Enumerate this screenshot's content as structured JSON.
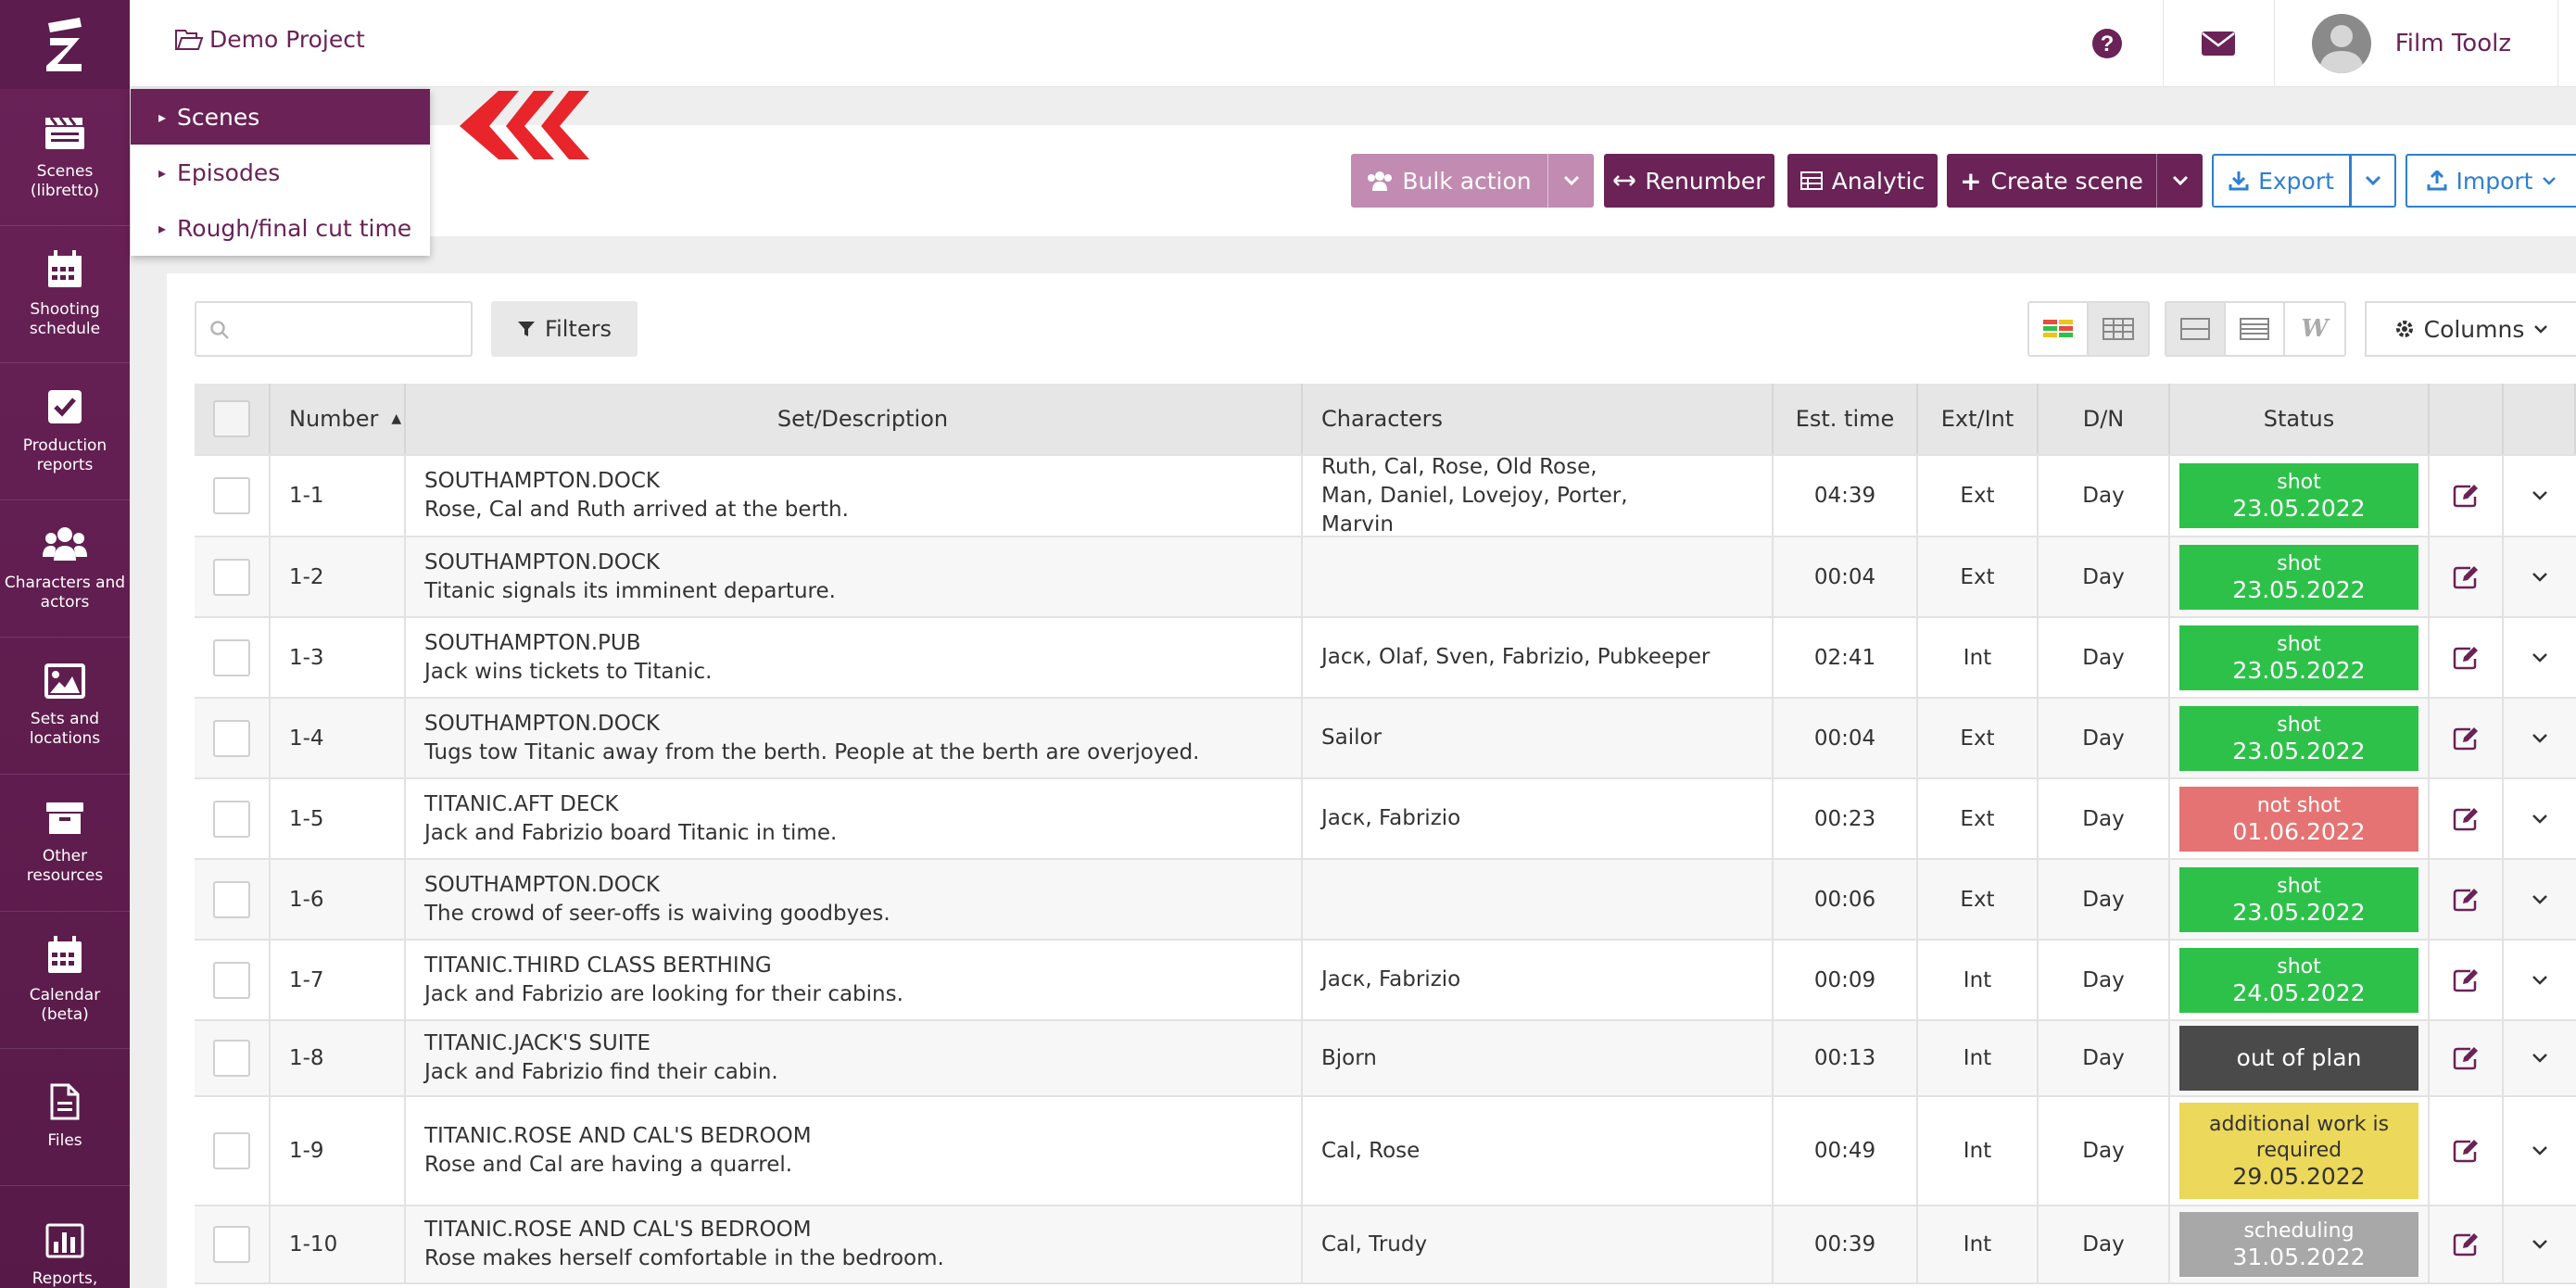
{
  "sidebar": {
    "items": [
      {
        "label": "Scenes (libretto)",
        "icon": "clapperboard-icon"
      },
      {
        "label": "Shooting schedule",
        "icon": "calendar-icon"
      },
      {
        "label": "Production reports",
        "icon": "checkbox-icon"
      },
      {
        "label": "Characters and actors",
        "icon": "users-icon"
      },
      {
        "label": "Sets and locations",
        "icon": "image-icon"
      },
      {
        "label": "Other resources",
        "icon": "archive-icon"
      },
      {
        "label": "Calendar (beta)",
        "icon": "calendar-icon"
      },
      {
        "label": "Files",
        "icon": "file-icon"
      },
      {
        "label": "Reports, analytics",
        "icon": "bar-chart-icon"
      }
    ]
  },
  "header": {
    "project": "Demo Project",
    "user_name": "Film Toolz"
  },
  "dropdown": {
    "items": [
      "Scenes",
      "Episodes",
      "Rough/final cut time"
    ]
  },
  "toolbar": {
    "bulk_action": "Bulk action",
    "renumber": "Renumber",
    "analytic": "Analytic",
    "create_scene": "Create scene",
    "export": "Export",
    "import": "Import"
  },
  "filters": {
    "search_placeholder": "",
    "filters_label": "Filters",
    "columns_label": "Columns"
  },
  "table": {
    "headers": {
      "number": "Number",
      "set": "Set/Description",
      "characters": "Characters",
      "time": "Est. time",
      "ext": "Ext/Int",
      "dn": "D/N",
      "status": "Status"
    },
    "rows": [
      {
        "num": "1-1",
        "set": "SOUTHAMPTON.DOCK",
        "desc": "Rose, Cal and Ruth arrived at the berth.",
        "chars": "Ruth, Cal, Rose, Old Rose, Man, Daniel, Lovejoy, Porter, Marvin",
        "time": "04:39",
        "ext": "Ext",
        "dn": "Day",
        "status": "shot",
        "date": "23.05.2022",
        "color": "#2ec14a",
        "text_color": "#ffffff"
      },
      {
        "num": "1-2",
        "set": "SOUTHAMPTON.DOCK",
        "desc": "Titanic signals its imminent departure.",
        "chars": "",
        "time": "00:04",
        "ext": "Ext",
        "dn": "Day",
        "status": "shot",
        "date": "23.05.2022",
        "color": "#2ec14a",
        "text_color": "#ffffff"
      },
      {
        "num": "1-3",
        "set": "SOUTHAMPTON.PUB",
        "desc": "Jack wins tickets to Titanic.",
        "chars": "Jacк, Olaf, Sven, Fabrizio, Pubkeeper",
        "time": "02:41",
        "ext": "Int",
        "dn": "Day",
        "status": "shot",
        "date": "23.05.2022",
        "color": "#2ec14a",
        "text_color": "#ffffff"
      },
      {
        "num": "1-4",
        "set": "SOUTHAMPTON.DOCK",
        "desc": "Tugs tow Titanic away from the berth. People at the berth are overjoyed.",
        "chars": "Sailor",
        "time": "00:04",
        "ext": "Ext",
        "dn": "Day",
        "status": "shot",
        "date": "23.05.2022",
        "color": "#2ec14a",
        "text_color": "#ffffff"
      },
      {
        "num": "1-5",
        "set": "TITANIC.AFT DECK",
        "desc": "Jack and Fabrizio board Titanic in time.",
        "chars": "Jacк, Fabrizio",
        "time": "00:23",
        "ext": "Ext",
        "dn": "Day",
        "status": "not shot",
        "date": "01.06.2022",
        "color": "#e57373",
        "text_color": "#ffffff"
      },
      {
        "num": "1-6",
        "set": "SOUTHAMPTON.DOCK",
        "desc": "The crowd of seer-offs is waiving goodbyes.",
        "chars": "",
        "time": "00:06",
        "ext": "Ext",
        "dn": "Day",
        "status": "shot",
        "date": "23.05.2022",
        "color": "#2ec14a",
        "text_color": "#ffffff"
      },
      {
        "num": "1-7",
        "set": "TITANIC.THIRD CLASS BERTHING",
        "desc": "Jack and Fabrizio are looking for their cabins.",
        "chars": "Jacк, Fabrizio",
        "time": "00:09",
        "ext": "Int",
        "dn": "Day",
        "status": "shot",
        "date": "24.05.2022",
        "color": "#2ec14a",
        "text_color": "#ffffff"
      },
      {
        "num": "1-8",
        "set": "TITANIC.JACK'S SUITE",
        "desc": "Jack and Fabrizio find their cabin.",
        "chars": "Bjorn",
        "time": "00:13",
        "ext": "Int",
        "dn": "Day",
        "status": "out of plan",
        "date": "",
        "color": "#4a4a4a",
        "text_color": "#ffffff"
      },
      {
        "num": "1-9",
        "set": "TITANIC.ROSE AND CAL'S BEDROOM",
        "desc": "Rose and Cal are having a quarrel.",
        "chars": "Cal, Rose",
        "time": "00:49",
        "ext": "Int",
        "dn": "Day",
        "status": "additional work is required",
        "date": "29.05.2022",
        "color": "#ecd85a",
        "text_color": "#333333"
      },
      {
        "num": "1-10",
        "set": "TITANIC.ROSE AND CAL'S BEDROOM",
        "desc": "Rose makes herself comfortable in the bedroom.",
        "chars": "Cal, Trudy",
        "time": "00:39",
        "ext": "Int",
        "dn": "Day",
        "status": "scheduling",
        "date": "31.05.2022",
        "color": "#a8a8a8",
        "text_color": "#ffffff"
      }
    ]
  }
}
